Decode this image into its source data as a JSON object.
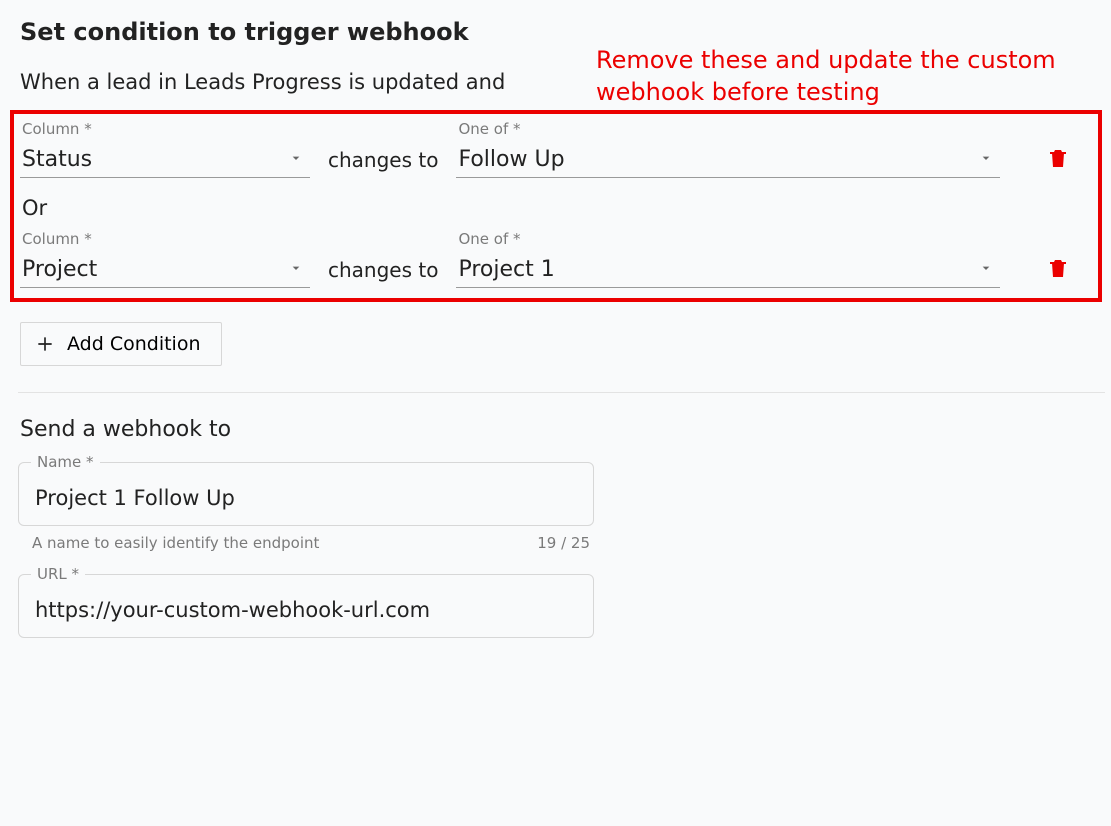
{
  "header": {
    "title": "Set condition to trigger webhook"
  },
  "annotation": "Remove these and update the custom webhook before testing",
  "trigger": {
    "intro": "When a lead in Leads Progress is updated and",
    "joiner": "changes to",
    "or_label": "Or",
    "labels": {
      "column": "Column *",
      "oneof": "One of *"
    },
    "rows": [
      {
        "column": "Status",
        "oneof": "Follow Up"
      },
      {
        "column": "Project",
        "oneof": "Project 1"
      }
    ],
    "add_button": "Add Condition"
  },
  "send": {
    "heading": "Send a webhook to",
    "name": {
      "label": "Name *",
      "value": "Project 1 Follow Up",
      "hint": "A name to easily identify the endpoint",
      "counter": "19 / 25"
    },
    "url": {
      "label": "URL *",
      "value": "https://your-custom-webhook-url.com"
    }
  },
  "icons": {
    "dropdown": "chevron-down-icon",
    "delete": "trash-icon",
    "plus": "plus-icon"
  }
}
